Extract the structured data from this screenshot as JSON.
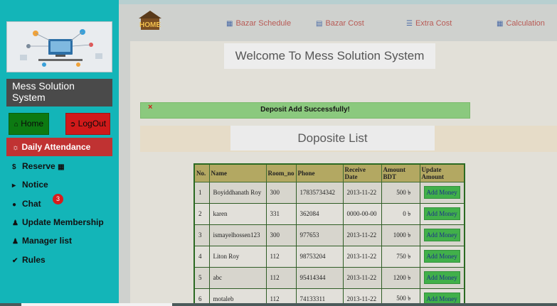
{
  "sidebar": {
    "system_title": "Mess Solution System",
    "home_label": "Home",
    "logout_label": "LogOut",
    "daily_attendance_label": "Daily Attendance",
    "links": {
      "reserve": "Reserve",
      "notice": "Notice",
      "chat": "Chat",
      "update_membership": "Update Membership",
      "manager_list": "Manager list",
      "rules": "Rules"
    },
    "chat_badge": "3"
  },
  "nav": {
    "bazar_schedule": "Bazar Schedule",
    "bazar_cost": "Bazar Cost",
    "extra_cost": "Extra Cost",
    "calculation": "Calculation"
  },
  "main": {
    "welcome": "Welcome To Mess Solution System",
    "alert_close": "×",
    "alert_text": "Deposit Add Successfully!",
    "list_title": "Doposite List"
  },
  "table": {
    "headers": [
      "No.",
      "Name",
      "Room_no",
      "Phone",
      "Receive Date",
      "Amount BDT",
      "Update Amount"
    ],
    "rows": [
      {
        "no": "1",
        "name": "Boyiddhanath Roy",
        "room": "300",
        "phone": "17835734342",
        "date": "2013-11-22",
        "amount": "500 ৳",
        "action": "Add Money"
      },
      {
        "no": "2",
        "name": "karen",
        "room": "331",
        "phone": "362084",
        "date": "0000-00-00",
        "amount": "0 ৳",
        "action": "Add Money"
      },
      {
        "no": "3",
        "name": "ismayelhossen123",
        "room": "300",
        "phone": "977653",
        "date": "2013-11-22",
        "amount": "1000 ৳",
        "action": "Add Money"
      },
      {
        "no": "4",
        "name": "Liton Roy",
        "room": "112",
        "phone": "98753204",
        "date": "2013-11-22",
        "amount": "750 ৳",
        "action": "Add Money"
      },
      {
        "no": "5",
        "name": "abc",
        "room": "112",
        "phone": "95414344",
        "date": "2013-11-22",
        "amount": "1200 ৳",
        "action": "Add Money"
      },
      {
        "no": "6",
        "name": "motaleb",
        "room": "112",
        "phone": "74133311",
        "date": "2013-11-22",
        "amount": "500 ৳",
        "action": "Add Money"
      }
    ]
  },
  "colors": {
    "sidebar": "#13b5b8",
    "home_button": "#0d7a12",
    "logout_button": "#d01a1a",
    "alert": "#8bc97e",
    "table_header": "#b3a862",
    "add_button": "#41b04a"
  },
  "icons": {
    "home": "home-icon",
    "logout": "sign-out-icon",
    "daily": "sun-icon",
    "reserve": "dollar-icon",
    "notice": "bullhorn-icon",
    "chat": "comment-icon",
    "membership": "user-plus-icon",
    "manager": "users-icon",
    "rules": "check-circle-icon",
    "bazar_schedule": "calendar-icon",
    "bazar_cost": "list-icon",
    "extra_cost": "bars-icon",
    "calculation": "calculator-icon"
  }
}
